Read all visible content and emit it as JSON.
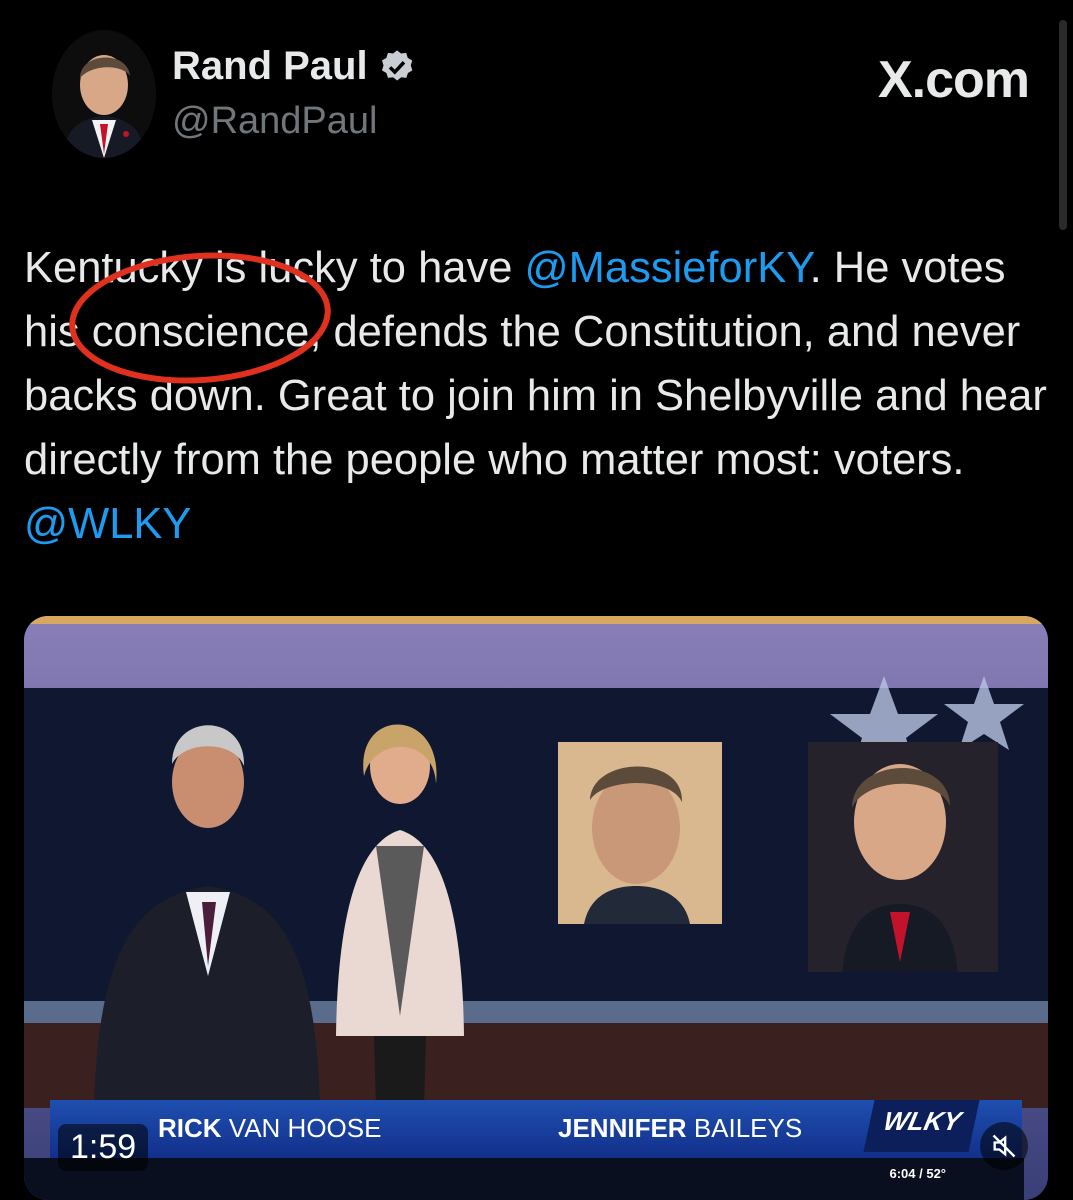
{
  "header": {
    "display_name": "Rand Paul",
    "handle": "@RandPaul",
    "brand": "X.com"
  },
  "tweet": {
    "segments": [
      {
        "text": "Kentucky is lucky to have ",
        "type": "text"
      },
      {
        "text": "@MassieforKY",
        "type": "mention"
      },
      {
        "text": ". He votes his conscience, defends the Constitution, and never backs down. Great to join him in Shelbyville and hear directly from the people who matter most: voters. ",
        "type": "text"
      },
      {
        "text": "@WLKY",
        "type": "mention"
      }
    ]
  },
  "video": {
    "duration": "1:59",
    "lower_third": {
      "anchor1_first": "RICK",
      "anchor1_last": "VAN HOOSE",
      "anchor2_first": "JENNIFER",
      "anchor2_last": "BAILEYS",
      "station_logo": "WLKY",
      "time_temp": "6:04 / 52°"
    }
  },
  "colors": {
    "background": "#000000",
    "text": "#e7e9ea",
    "secondary_text": "#71767b",
    "link": "#1d9bf0",
    "annotation": "#e0301e",
    "lower_third": "#1f4fb0"
  },
  "icons": [
    "verified-badge-icon",
    "mute-icon"
  ]
}
